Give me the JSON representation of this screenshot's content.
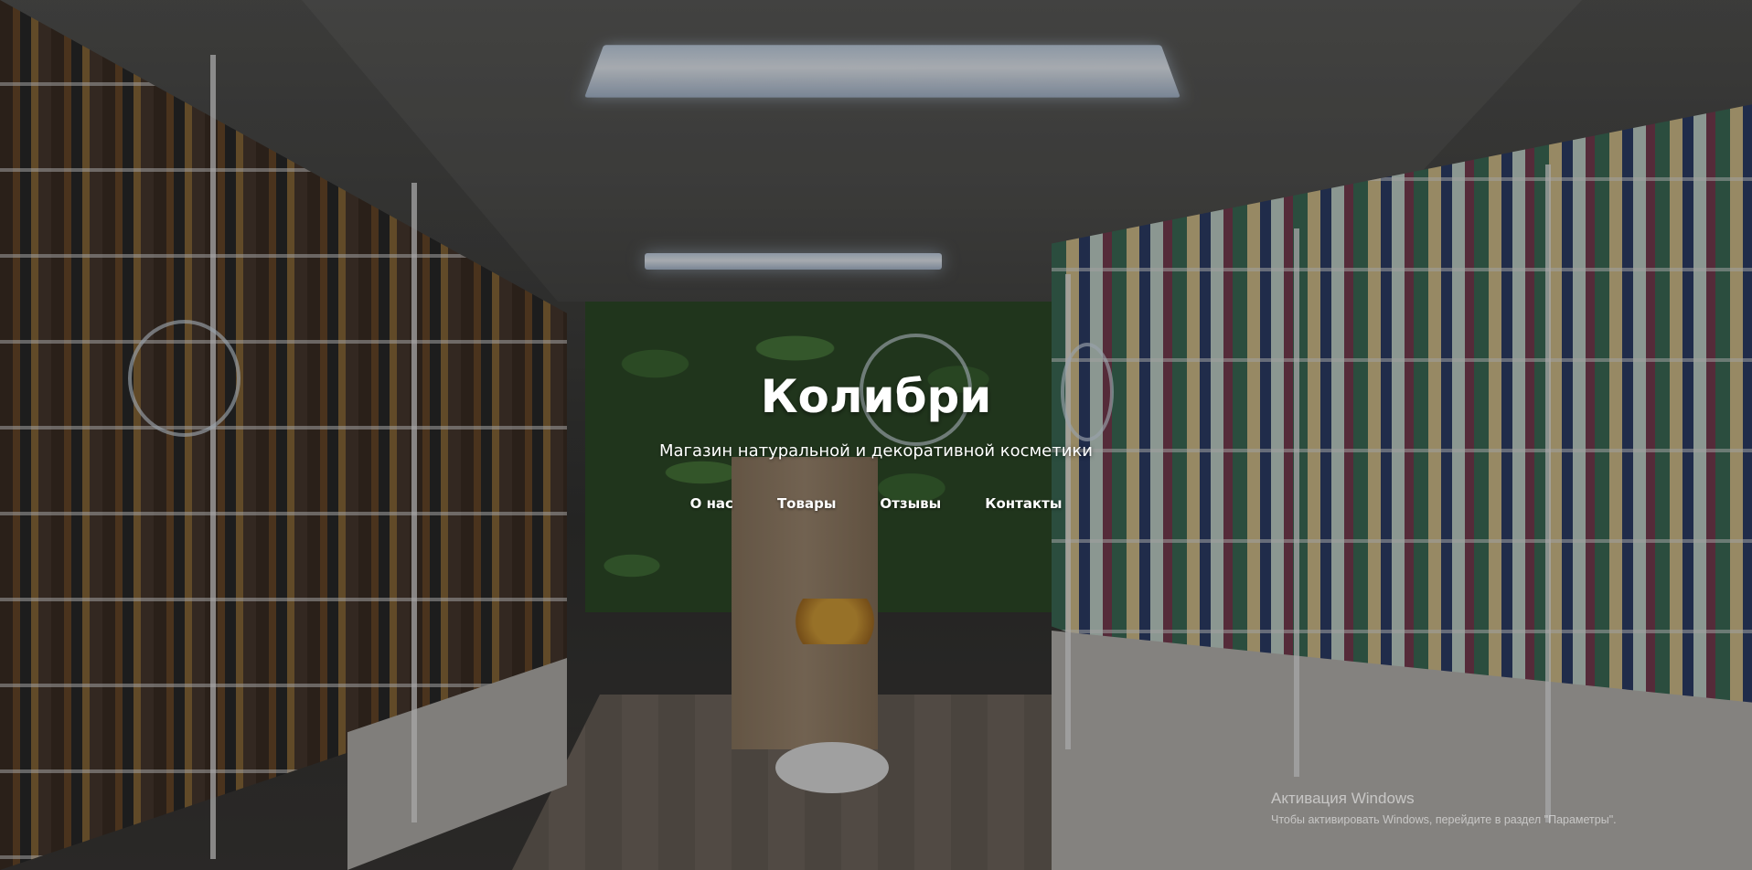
{
  "site": {
    "title": "Колибри",
    "subtitle": "Магазин натуральной и декоративной косметики"
  },
  "nav": {
    "items": [
      {
        "label": "О нас"
      },
      {
        "label": "Товары"
      },
      {
        "label": "Отзывы"
      },
      {
        "label": "Контакты"
      }
    ]
  },
  "watermark": {
    "title": "Активация Windows",
    "message": "Чтобы активировать Windows, перейдите в раздел \"Параметры\"."
  },
  "colors": {
    "text": "#ffffff",
    "overlay": "rgba(0,0,0,0.30)"
  },
  "background": {
    "image_icon": "cosmetics-store-interior-photo"
  }
}
